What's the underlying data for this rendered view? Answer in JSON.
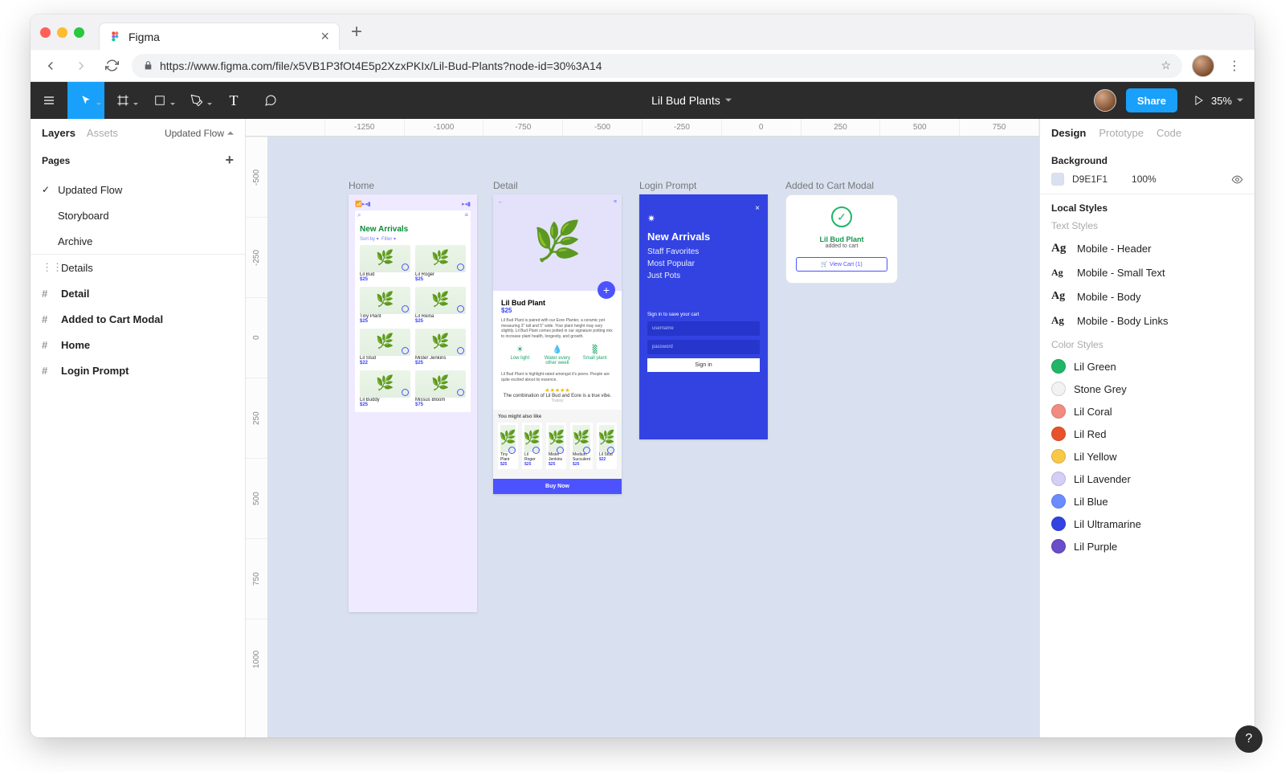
{
  "browser": {
    "tab_title": "Figma",
    "url": "https://www.figma.com/file/x5VB1P3fOt4E5p2XzxPKIx/Lil-Bud-Plants?node-id=30%3A14"
  },
  "app": {
    "document_title": "Lil Bud Plants",
    "share_label": "Share",
    "zoom": "35%"
  },
  "left_panel": {
    "tabs": [
      "Layers",
      "Assets"
    ],
    "page_selector": "Updated Flow",
    "pages_header": "Pages",
    "pages": [
      {
        "name": "Updated Flow",
        "selected": true
      },
      {
        "name": "Storyboard",
        "selected": false
      },
      {
        "name": "Archive",
        "selected": false
      }
    ],
    "layers": [
      {
        "name": "Details",
        "icon": "component",
        "bold": false
      },
      {
        "name": "Detail",
        "icon": "frame",
        "bold": true
      },
      {
        "name": "Added to Cart Modal",
        "icon": "frame",
        "bold": true
      },
      {
        "name": "Home",
        "icon": "frame",
        "bold": true
      },
      {
        "name": "Login Prompt",
        "icon": "frame",
        "bold": true
      }
    ]
  },
  "right_panel": {
    "tabs": [
      "Design",
      "Prototype",
      "Code"
    ],
    "background": {
      "label": "Background",
      "hex": "D9E1F1",
      "opacity": "100%"
    },
    "local_styles_header": "Local Styles",
    "text_styles_header": "Text Styles",
    "text_styles": [
      "Mobile - Header",
      "Mobile - Small Text",
      "Mobile - Body",
      "Mobile - Body Links"
    ],
    "color_styles_header": "Color Styles",
    "color_styles": [
      {
        "name": "Lil Green",
        "hex": "#21B567"
      },
      {
        "name": "Stone Grey",
        "hex": "#F2F2F2"
      },
      {
        "name": "Lil Coral",
        "hex": "#F28B82"
      },
      {
        "name": "Lil Red",
        "hex": "#E8522B"
      },
      {
        "name": "Lil Yellow",
        "hex": "#F9C846"
      },
      {
        "name": "Lil Lavender",
        "hex": "#D3CFF7"
      },
      {
        "name": "Lil Blue",
        "hex": "#6B8CFF"
      },
      {
        "name": "Lil Ultramarine",
        "hex": "#3343E2"
      },
      {
        "name": "Lil Purple",
        "hex": "#6A4DC8"
      }
    ]
  },
  "ruler_h": [
    "",
    "-1250",
    "-1000",
    "-750",
    "-500",
    "-250",
    "0",
    "250",
    "500",
    "750"
  ],
  "ruler_v": [
    "-500",
    "-250",
    "0",
    "250",
    "500",
    "750",
    "1000"
  ],
  "frames": {
    "home": {
      "label": "Home",
      "title": "New Arrivals",
      "sort": "Sort by ▾",
      "filter": "Filter ▾",
      "products": [
        {
          "name": "Lil Bud",
          "price": "$25"
        },
        {
          "name": "Lil Roger",
          "price": "$25"
        },
        {
          "name": "Tiny Plant",
          "price": "$25"
        },
        {
          "name": "Lil Reina",
          "price": "$25"
        },
        {
          "name": "Lil Stud",
          "price": "$22"
        },
        {
          "name": "Mister Jenkins",
          "price": "$25"
        },
        {
          "name": "Lil Buddy",
          "price": "$25"
        },
        {
          "name": "Missus Bloom",
          "price": "$75"
        }
      ]
    },
    "detail": {
      "label": "Detail",
      "title": "Lil Bud Plant",
      "price": "$25",
      "desc": "Lil Bud Plant is paired with our Eore Planter, a ceramic pot measuring 3\" tall and 5\" wide. Your plant height may vary slightly. Lil Bud Plant comes potted in our signature potting mix to increase plant health, longevity, and growth.",
      "tags": [
        {
          "icon": "☀",
          "label": "Low light"
        },
        {
          "icon": "💧",
          "label": "Water every other week"
        },
        {
          "icon": "␩",
          "label": "Small plant"
        }
      ],
      "review_intro": "Lil Bud Plant is highlight-rated amongst it's peers. People are quite excited about its essence.",
      "review_quote": "The combination of Lil Bud and Eore is a true vibe.",
      "review_by": "Tracey",
      "related_header": "You might also like",
      "related": [
        {
          "name": "Tiny Plant",
          "price": "$25"
        },
        {
          "name": "Lil Roger",
          "price": "$25"
        },
        {
          "name": "Mister Jenkins",
          "price": "$25"
        },
        {
          "name": "Medium Succulent",
          "price": "$25"
        },
        {
          "name": "Lil Stud",
          "price": "$22"
        }
      ],
      "buy_label": "Buy Now"
    },
    "login": {
      "label": "Login Prompt",
      "title": "New Arrivals",
      "links": [
        "Staff Favorites",
        "Most Popular",
        "Just Pots"
      ],
      "sign_label": "Sign in to save your cart",
      "username_ph": "username",
      "password_ph": "password",
      "signin": "Sign in"
    },
    "modal": {
      "label": "Added to Cart Modal",
      "title": "Lil Bud Plant",
      "subtitle": "added to cart",
      "view_cart": "🛒  View Cart (1)"
    }
  }
}
